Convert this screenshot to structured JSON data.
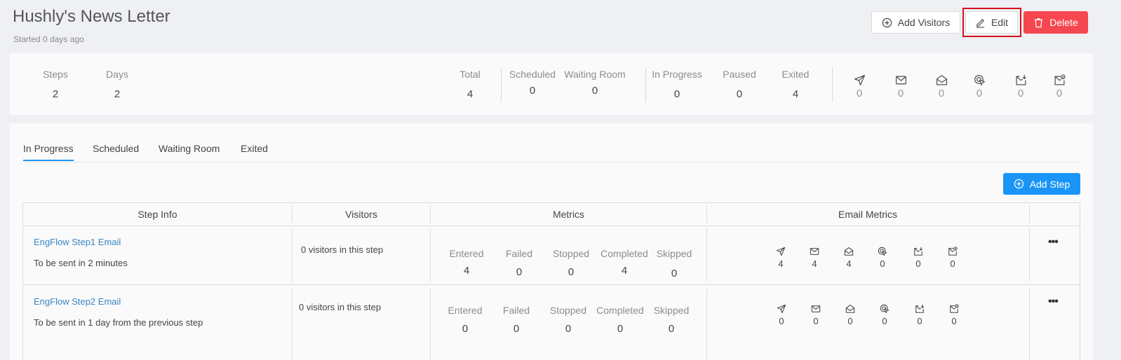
{
  "header": {
    "title": "Hushly's News Letter",
    "subtitle": "Started 0 days ago",
    "add_visitors_label": "Add Visitors",
    "edit_label": "Edit",
    "delete_label": "Delete"
  },
  "stats": {
    "steps_label": "Steps",
    "steps_value": "2",
    "days_label": "Days",
    "days_value": "2",
    "total_label": "Total",
    "total_value": "4",
    "scheduled_label": "Scheduled",
    "scheduled_value": "0",
    "waiting_label": "Waiting Room",
    "waiting_value": "0",
    "inprogress_label": "In Progress",
    "inprogress_value": "0",
    "paused_label": "Paused",
    "paused_value": "0",
    "exited_label": "Exited",
    "exited_value": "4",
    "email_metrics": [
      {
        "icon": "send-icon",
        "value": "0"
      },
      {
        "icon": "mail-icon",
        "value": "0"
      },
      {
        "icon": "mail-open-icon",
        "value": "0"
      },
      {
        "icon": "click-icon",
        "value": "0"
      },
      {
        "icon": "mail-download-icon",
        "value": "0"
      },
      {
        "icon": "mail-check-icon",
        "value": "0"
      }
    ]
  },
  "tabs": [
    "In Progress",
    "Scheduled",
    "Waiting Room",
    "Exited"
  ],
  "active_tab": "In Progress",
  "add_step_label": "Add Step",
  "table": {
    "headers": [
      "Step Info",
      "Visitors",
      "Metrics",
      "Email Metrics"
    ],
    "rows": [
      {
        "name": "EngFlow Step1 Email",
        "schedule": "To be sent in 2 minutes",
        "visitors": "0 visitors in this step",
        "metrics": [
          {
            "label": "Entered",
            "value": "4"
          },
          {
            "label": "Failed",
            "value": "0"
          },
          {
            "label": "Stopped",
            "value": "0"
          },
          {
            "label": "Completed",
            "value": "4"
          },
          {
            "label": "Skipped",
            "value": "0"
          }
        ],
        "email": [
          "4",
          "4",
          "4",
          "0",
          "0",
          "0"
        ],
        "more": "•••"
      },
      {
        "name": "EngFlow Step2 Email",
        "schedule": "To be sent in 1 day from the previous step",
        "visitors": "0 visitors in this step",
        "metrics": [
          {
            "label": "Entered",
            "value": "0"
          },
          {
            "label": "Failed",
            "value": "0"
          },
          {
            "label": "Stopped",
            "value": "0"
          },
          {
            "label": "Completed",
            "value": "0"
          },
          {
            "label": "Skipped",
            "value": "0"
          }
        ],
        "email": [
          "0",
          "0",
          "0",
          "0",
          "0",
          "0"
        ],
        "more": "•••"
      }
    ]
  },
  "colors": {
    "accent": "#1b95f5",
    "danger": "#f5474f",
    "link": "#3a86c2",
    "highlight": "#d7101b"
  }
}
